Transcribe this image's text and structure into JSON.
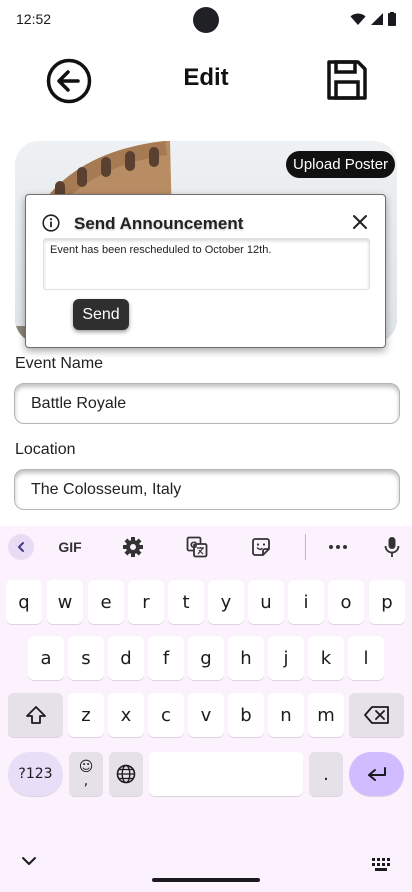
{
  "status": {
    "time": "12:52"
  },
  "appbar": {
    "title": "Edit"
  },
  "poster": {
    "upload_label": "Upload Poster"
  },
  "dialog": {
    "title": "Send Announcement",
    "message": "Event has been rescheduled to October 12th.",
    "send_label": "Send"
  },
  "form": {
    "event_name_label": "Event Name",
    "event_name_value": "Battle Royale",
    "location_label": "Location",
    "location_value": "The Colosseum, Italy"
  },
  "keyboard": {
    "toolbar": {
      "gif_label": "GIF"
    },
    "row1": [
      "q",
      "w",
      "e",
      "r",
      "t",
      "y",
      "u",
      "i",
      "o",
      "p"
    ],
    "row2": [
      "a",
      "s",
      "d",
      "f",
      "g",
      "h",
      "j",
      "k",
      "l"
    ],
    "row3": [
      "z",
      "x",
      "c",
      "v",
      "b",
      "n",
      "m"
    ],
    "symbols_label": "?123",
    "emoji_label": "☺",
    "comma_label": ",",
    "period_label": "."
  },
  "colors": {
    "keyboard_bg": "#fcf2fe",
    "enter_key": "#d0bcff",
    "func_key": "#e6e0e9",
    "upload_button": "#111111"
  }
}
